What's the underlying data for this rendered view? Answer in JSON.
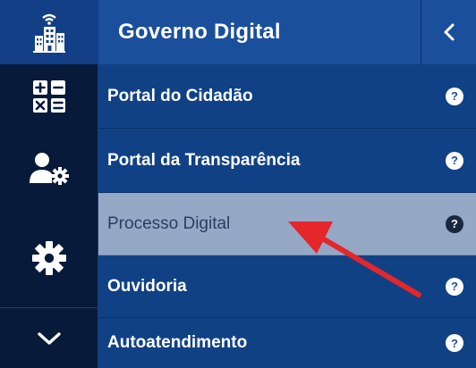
{
  "panel": {
    "title": "Governo Digital"
  },
  "menu": {
    "items": [
      {
        "label": "Portal do Cidadão",
        "help": "?"
      },
      {
        "label": "Portal da Transparência",
        "help": "?"
      },
      {
        "label": "Processo Digital",
        "help": "?"
      },
      {
        "label": "Ouvidoria",
        "help": "?"
      },
      {
        "label": "Autoatendimento",
        "help": "?"
      }
    ]
  },
  "icons": {
    "rail": [
      "smart-city-icon",
      "calculator-icon",
      "user-settings-icon",
      "gear-icon",
      "chevron-down-icon"
    ],
    "collapse": "chevron-left-icon"
  },
  "colors": {
    "rail_background": "#081a3a",
    "panel_background": "#114185",
    "header_background": "#1a4f9c",
    "highlight_background": "#95a8c6",
    "annotation_arrow": "#e5262a"
  }
}
